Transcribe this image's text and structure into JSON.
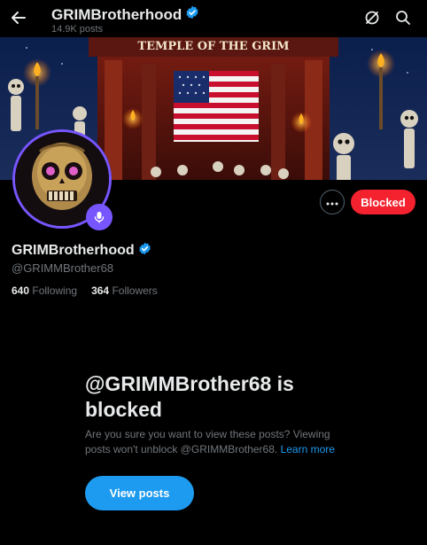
{
  "header": {
    "display_name": "GRIMBrotherhood",
    "post_count": "14.9K posts"
  },
  "banner": {
    "sign_text": "TEMPLE OF THE GRIM"
  },
  "profile": {
    "display_name": "GRIMBrotherhood",
    "handle": "@GRIMMBrother68",
    "following_count": "640",
    "following_label": "Following",
    "followers_count": "364",
    "followers_label": "Followers"
  },
  "actions": {
    "blocked_label": "Blocked",
    "more_icon": "more-dots-icon"
  },
  "blocked_notice": {
    "title": "@GRIMMBrother68 is blocked",
    "description": "Are you sure you want to view these posts? Viewing posts won't unblock @GRIMMBrother68.",
    "learn_more": "Learn more",
    "view_posts_label": "View posts"
  },
  "colors": {
    "accent": "#1d9bf0",
    "blocked": "#f4212e",
    "avatar_ring": "#7856ff",
    "verified": "#1d9bf0"
  },
  "icons": [
    "back-arrow-icon",
    "verified-badge-icon",
    "grok-icon",
    "search-icon",
    "microphone-icon",
    "more-dots-icon"
  ]
}
